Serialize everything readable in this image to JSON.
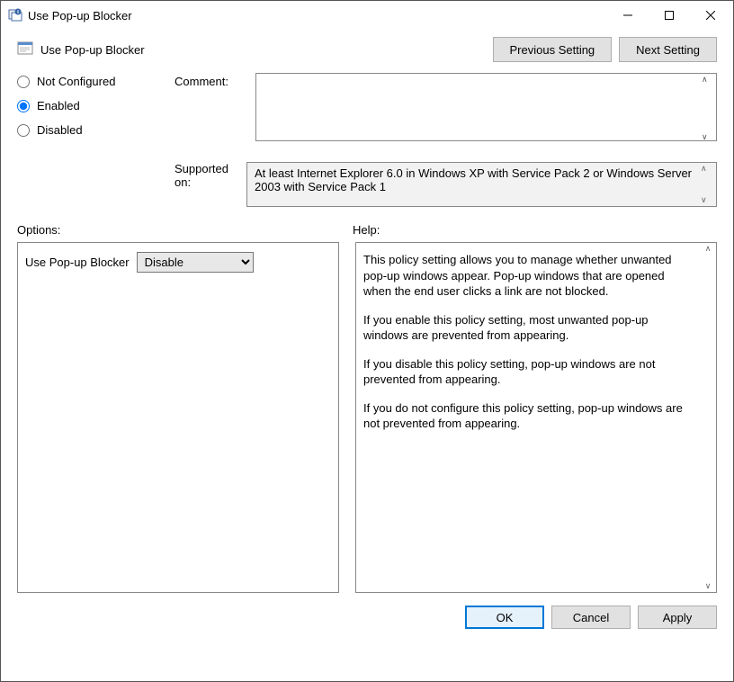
{
  "window": {
    "title": "Use Pop-up Blocker"
  },
  "header": {
    "policy_title": "Use Pop-up Blocker",
    "prev_label": "Previous Setting",
    "next_label": "Next Setting"
  },
  "state": {
    "not_configured": "Not Configured",
    "enabled": "Enabled",
    "disabled": "Disabled",
    "selected": "enabled"
  },
  "fields": {
    "comment_label": "Comment:",
    "comment_value": "",
    "supported_label": "Supported on:",
    "supported_value": "At least Internet Explorer 6.0 in Windows XP with Service Pack 2 or Windows Server 2003 with Service Pack 1"
  },
  "panes": {
    "options_label": "Options:",
    "help_label": "Help:"
  },
  "options": {
    "item_label": "Use Pop-up Blocker",
    "dropdown_value": "Disable"
  },
  "help": {
    "p1": "This policy setting allows you to manage whether unwanted pop-up windows appear. Pop-up windows that are opened when the end user clicks a link are not blocked.",
    "p2": "If you enable this policy setting, most unwanted pop-up windows are prevented from appearing.",
    "p3": "If you disable this policy setting, pop-up windows are not prevented from appearing.",
    "p4": "If you do not configure this policy setting, pop-up windows are not prevented from appearing."
  },
  "footer": {
    "ok": "OK",
    "cancel": "Cancel",
    "apply": "Apply"
  }
}
